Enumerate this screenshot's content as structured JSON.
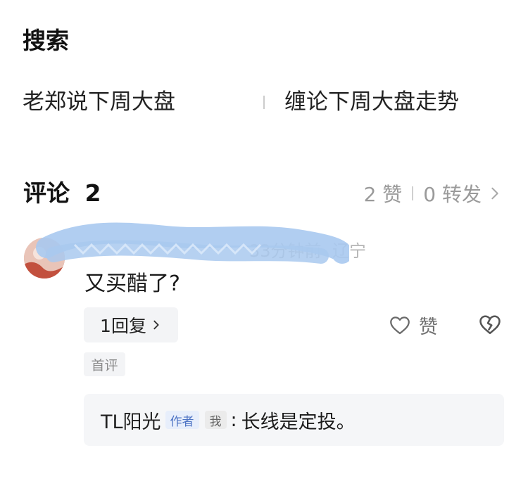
{
  "search": {
    "title": "搜索",
    "suggestions": [
      "老郑说下周大盘",
      "缠论下周大盘走势"
    ]
  },
  "comments_header": {
    "title_label": "评论",
    "count": "2",
    "likes": "2 赞",
    "reposts": "0 转发"
  },
  "comment": {
    "meta_time": "33分钟前",
    "location": "辽宁",
    "text": "又买醋了?",
    "reply_button_label": "1回复",
    "like_label": "赞",
    "badge_first": "首评",
    "reply": {
      "author": "TL阳光",
      "tag_author": "作者",
      "tag_me": "我",
      "separator": ":",
      "text": "长线是定投。"
    }
  },
  "colors": {
    "accent_blue": "#4e74c4",
    "muted_gray": "#9a9a9a",
    "scribble_blue": "#a9c9ef"
  }
}
